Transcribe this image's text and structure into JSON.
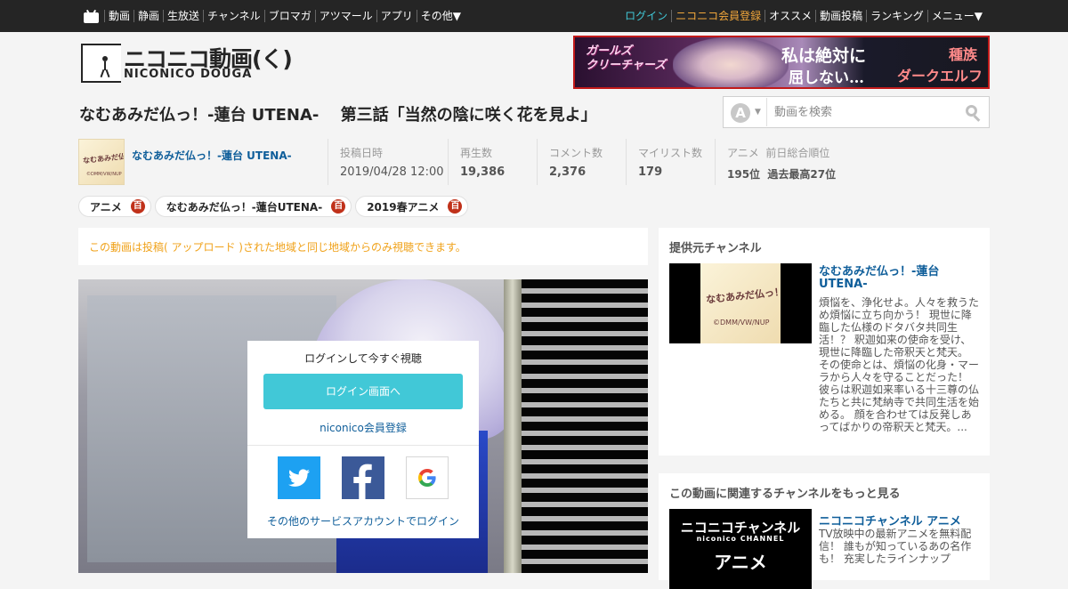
{
  "topbar": {
    "left": [
      "動画",
      "静画",
      "生放送",
      "チャンネル",
      "ブロマガ",
      "アツマール",
      "アプリ",
      "その他▼"
    ],
    "login": "ログイン",
    "register": "ニコニコ会員登録",
    "right": [
      "オススメ",
      "動画投稿",
      "ランキング",
      "メニュー▼"
    ]
  },
  "logo": {
    "jp": "ニコニコ動画(く)",
    "en": "NICONICO DOUGA"
  },
  "banner": {
    "left": "ガールズ\nクリーチャーズ",
    "main1": "私は絶対に",
    "main2": "屈しない…",
    "sub1": "種族",
    "sub2": "ダークエルフ"
  },
  "video": {
    "title": "なむあみだ仏っ！-蓮台 UTENA-　 第三話「当然の陰に咲く花を見よ」"
  },
  "search": {
    "mode": "A",
    "placeholder": "動画を検索"
  },
  "channel": {
    "name": "なむあみだ仏っ！-蓮台 UTENA-",
    "thumb_text": "なむあみだ仏っ！",
    "thumb_copy": "©DMM/VW/NUP"
  },
  "stats": {
    "posted_label": "投稿日時",
    "posted": "2019/04/28 12:00",
    "views_label": "再生数",
    "views": "19,386",
    "comments_label": "コメント数",
    "comments": "2,376",
    "mylist_label": "マイリスト数",
    "mylist": "179",
    "genre": "アニメ",
    "rank_label": "前日総合順位",
    "rank": "195位",
    "best_rank": "過去最高27位"
  },
  "tags": [
    {
      "name": "アニメ",
      "dic": "百"
    },
    {
      "name": "なむあみだ仏っ！-蓮台UTENA-",
      "dic": "百"
    },
    {
      "name": "2019春アニメ",
      "dic": "百"
    }
  ],
  "notice": "この動画は投稿( アップロード )された地域と同じ地域からのみ視聴できます。",
  "login_box": {
    "prompt": "ログインして今すぐ視聴",
    "button": "ログイン画面へ",
    "register": "niconico会員登録",
    "other": "その他のサービスアカウントでログイン"
  },
  "provider": {
    "title": "提供元チャンネル",
    "channel_title": "なむあみだ仏っ！-蓮台 UTENA-",
    "thumb_text": "なむあみだ仏っ！",
    "thumb_copy": "©DMM/VW/NUP",
    "description": "煩悩を、浄化せよ。人々を救うため煩悩に立ち向かう！ 現世に降臨した仏様のドタバタ共同生活！？ 釈迦如来の使命を受け、現世に降臨した帝釈天と梵天。 その使命とは、煩悩の化身・マーラから人々を守ることだった！ 彼らは釈迦如来率いる十三尊の仏たちと共に梵納寺で共同生活を始める。 顔を合わせては反発しあってばかりの帝釈天と梵天。..."
  },
  "related": {
    "title": "この動画に関連するチャンネルをもっと見る",
    "channel_title": "ニコニコチャンネル アニメ",
    "thumb_line1": "ニコニコチャンネル",
    "thumb_line2": "niconico CHANNEL",
    "thumb_line3": "アニメ",
    "description": "TV放映中の最新アニメを無料配信！ 誰もが知っているあの名作も！ 充実したラインナップ"
  }
}
